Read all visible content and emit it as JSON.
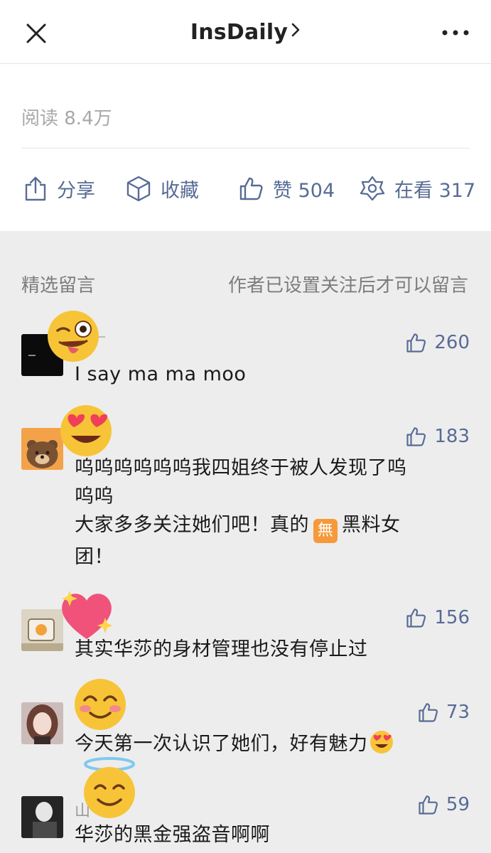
{
  "header": {
    "title": "InsDaily",
    "chevron_icon": "chevron-right-icon",
    "close_icon": "close-icon",
    "more_icon": "more-icon"
  },
  "article": {
    "read_label": "阅读 8.4万",
    "actions": {
      "share": "分享",
      "favorite": "收藏",
      "like": "赞 504",
      "looking": "在看 317"
    }
  },
  "comments_section": {
    "title": "精选留言",
    "notice": "作者已设置关注后才可以留言",
    "items": [
      {
        "likes": "260",
        "text": "I say ma ma moo",
        "emoji": "winking-tongue-emoji"
      },
      {
        "likes": "183",
        "text_line1": "呜呜呜呜呜呜我四姐终于被人发现了呜",
        "text_line2": "呜呜",
        "text_line3a": "大家多多关注她们吧！真的",
        "text_line3b": "黑料女",
        "text_line4": "团！",
        "badge": "無",
        "emoji": "heart-eyes-emoji"
      },
      {
        "likes": "156",
        "text": "其实华莎的身材管理也没有停止过",
        "emoji": "sparkling-heart-emoji"
      },
      {
        "likes": "73",
        "text": "今天第一次认识了她们，好有魅力",
        "emoji": "smiling-blush-emoji"
      },
      {
        "nick": "山",
        "likes": "59",
        "text": "华莎的黑金强盗音啊啊",
        "emoji": "halo-smile-emoji"
      }
    ]
  },
  "colors": {
    "link_blue": "#576b95",
    "page_gray": "#ededed",
    "emoji_yellow": "#f7c438"
  }
}
